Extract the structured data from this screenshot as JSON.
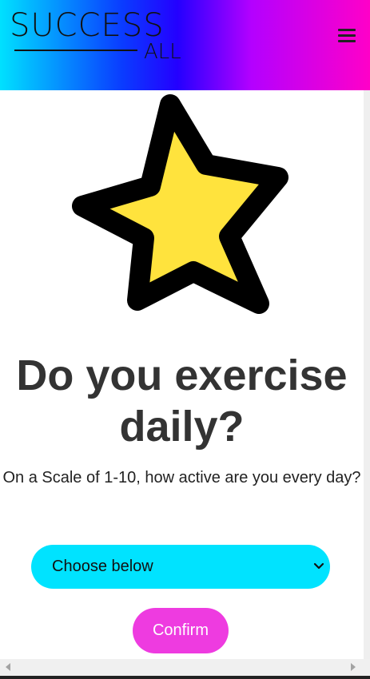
{
  "header": {
    "logo_top": "SUCCESS",
    "logo_bottom": "ALL",
    "menu_icon": "hamburger-menu-icon"
  },
  "hero": {
    "icon": "star-icon",
    "star_fill": "#ffe33d",
    "star_stroke": "#000000"
  },
  "question": {
    "title": "Do you exercise daily?",
    "subtitle": "On a Scale of 1-10, how active are you every day?"
  },
  "form": {
    "select_value": "Choose below",
    "select_color": "#00e3ff",
    "confirm_label": "Confirm",
    "confirm_color": "#ee3be0"
  }
}
